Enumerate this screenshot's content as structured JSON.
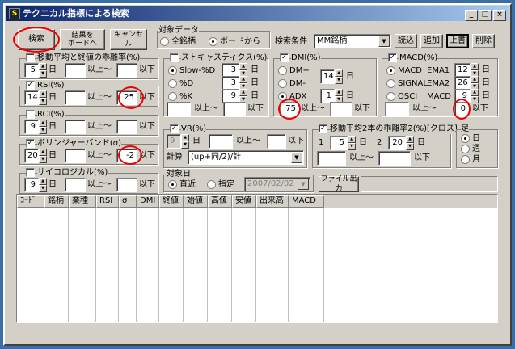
{
  "window": {
    "title": "テクニカル指標による検索",
    "icon": "app-icon",
    "minimize": "_",
    "maximize": "□",
    "close": "×"
  },
  "buttons": {
    "search": "検索",
    "board_result": "結果を\nボードへ",
    "cancel": "キャンセル",
    "load": "読込",
    "add": "追加",
    "overwrite": "上書",
    "delete": "削除",
    "file_output": "ファイル出力"
  },
  "target": {
    "label": "対象データ",
    "all": "全銘柄",
    "board": "ボードから"
  },
  "condition": {
    "label": "検索条件",
    "value": "MM銘柄"
  },
  "common": {
    "day": "日",
    "ge": "以上～",
    "le": "以下"
  },
  "ma_div": {
    "label": "移動平均と終値の乖離率(%)",
    "checked": false,
    "period": "5",
    "min": "",
    "max": ""
  },
  "rsi": {
    "label": "RSI(%)",
    "checked": true,
    "period": "14",
    "min": "",
    "max": "25"
  },
  "rci": {
    "label": "RCI(%)",
    "checked": false,
    "period": "9",
    "min": "",
    "max": ""
  },
  "bollinger": {
    "label": "ボリンジャーバンド(σ)",
    "checked": true,
    "period": "20",
    "min": "",
    "max": "-2"
  },
  "psycho": {
    "label": "サイコロジカル(%)",
    "checked": false,
    "period": "9",
    "min": "",
    "max": ""
  },
  "stoch": {
    "label": "ストキャスティクス(%)",
    "checked": false,
    "opt1": "Slow-%D",
    "opt2": "%D",
    "opt3": "%K",
    "p1": "3",
    "p2": "3",
    "p3": "9",
    "min": "",
    "max": ""
  },
  "dmi": {
    "label": "DMI(%)",
    "checked": true,
    "opt1": "DM+",
    "opt2": "DM-",
    "opt3": "ADX",
    "p1": "14",
    "p2": "1",
    "min": "75",
    "max": ""
  },
  "macd": {
    "label": "MACD(%)",
    "checked": true,
    "opt1": "MACD",
    "opt2": "SIGNAL",
    "opt3": "OSCI",
    "ema1_label": "EMA1",
    "ema2_label": "EMA2",
    "macd_label": "MACD",
    "ema1": "12",
    "ema2": "26",
    "macd_p": "9",
    "min": "",
    "max": "0"
  },
  "vr": {
    "label": "VR(%)",
    "checked": true,
    "period": "9",
    "min": "",
    "max": "",
    "calc_label": "計算",
    "calc": "(up+同/2)/計"
  },
  "ma2": {
    "label": "移動平均2本の乖離率2(%)[クロス]",
    "checked": true,
    "n1": "1",
    "p1": "5",
    "n2": "2",
    "p2": "20",
    "min": "",
    "max": ""
  },
  "foot": {
    "label": "足",
    "daily": "日",
    "weekly": "週",
    "monthly": "月"
  },
  "target_date": {
    "label": "対象日",
    "recent": "直近",
    "specify": "指定",
    "date": "2007/02/02"
  },
  "columns": [
    "ｺｰﾄﾞ",
    "銘柄",
    "業種",
    "RSI",
    "σ",
    "DMI",
    "終値",
    "始値",
    "高値",
    "安値",
    "出来高",
    "MACD"
  ]
}
